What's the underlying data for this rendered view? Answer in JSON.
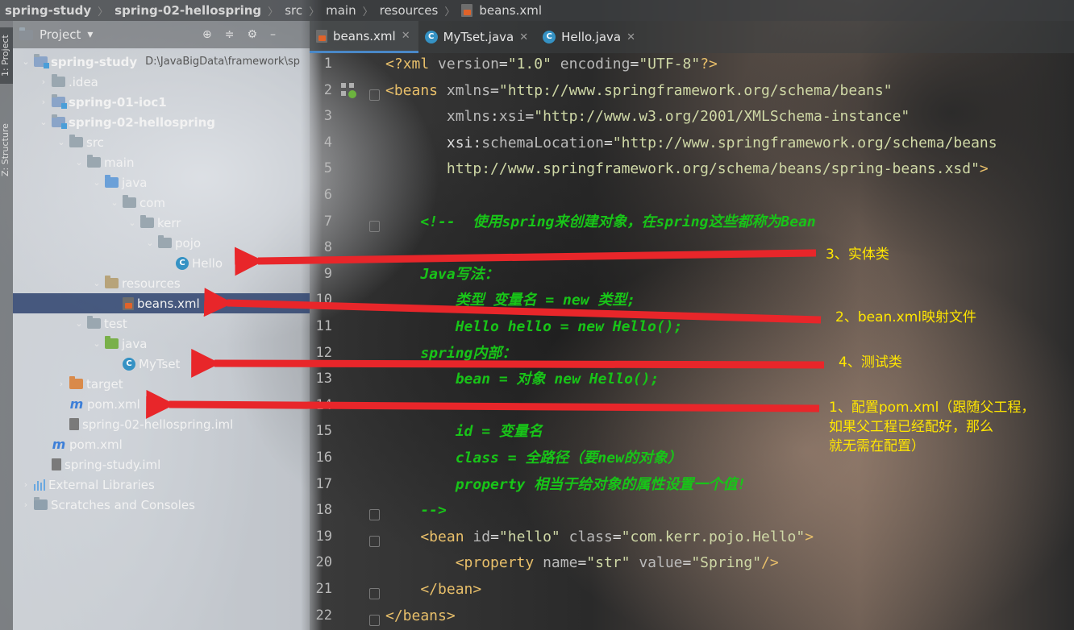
{
  "breadcrumb": {
    "items": [
      "spring-study",
      "spring-02-hellospring",
      "src",
      "main",
      "resources"
    ],
    "file": "beans.xml"
  },
  "left_stripe": {
    "project_label": "1: Project",
    "structure_label": "Z: Structure"
  },
  "project_panel": {
    "title": "Project",
    "root_path": "D:\\JavaBigData\\framework\\sp",
    "tree": [
      {
        "label": "spring-study",
        "icon": "module-folder-icon",
        "depth": 0,
        "expanded": true
      },
      {
        "label": ".idea",
        "icon": "folder-icon",
        "depth": 1,
        "expanded": false
      },
      {
        "label": "spring-01-ioc1",
        "icon": "module-folder-icon",
        "depth": 1,
        "expanded": false
      },
      {
        "label": "spring-02-hellospring",
        "icon": "module-folder-icon",
        "depth": 1,
        "expanded": true
      },
      {
        "label": "src",
        "icon": "folder-icon",
        "depth": 2,
        "expanded": true
      },
      {
        "label": "main",
        "icon": "folder-icon",
        "depth": 3,
        "expanded": true
      },
      {
        "label": "java",
        "icon": "source-folder-icon",
        "depth": 4,
        "expanded": true
      },
      {
        "label": "com",
        "icon": "package-icon",
        "depth": 5,
        "expanded": true
      },
      {
        "label": "kerr",
        "icon": "package-icon",
        "depth": 6,
        "expanded": true
      },
      {
        "label": "pojo",
        "icon": "package-icon",
        "depth": 7,
        "expanded": true
      },
      {
        "label": "Hello",
        "icon": "class-icon",
        "depth": 8
      },
      {
        "label": "resources",
        "icon": "resources-folder-icon",
        "depth": 4,
        "expanded": true
      },
      {
        "label": "beans.xml",
        "icon": "spring-xml-icon",
        "depth": 5,
        "selected": true
      },
      {
        "label": "test",
        "icon": "folder-icon",
        "depth": 3,
        "expanded": true
      },
      {
        "label": "java",
        "icon": "test-folder-icon",
        "depth": 4,
        "expanded": true
      },
      {
        "label": "MyTset",
        "icon": "class-icon",
        "depth": 5
      },
      {
        "label": "target",
        "icon": "target-folder-icon",
        "depth": 2,
        "expanded": false
      },
      {
        "label": "pom.xml",
        "icon": "maven-icon",
        "depth": 2
      },
      {
        "label": "spring-02-hellospring.iml",
        "icon": "iml-file-icon",
        "depth": 2
      },
      {
        "label": "pom.xml",
        "icon": "maven-icon",
        "depth": 1
      },
      {
        "label": "spring-study.iml",
        "icon": "iml-file-icon",
        "depth": 1
      },
      {
        "label": "External Libraries",
        "icon": "library-icon",
        "depth": 0,
        "expanded": false
      },
      {
        "label": "Scratches and Consoles",
        "icon": "scratches-icon",
        "depth": 0,
        "expanded": false
      }
    ]
  },
  "tabs": [
    {
      "label": "beans.xml",
      "icon": "spring-xml-icon",
      "active": true
    },
    {
      "label": "MyTset.java",
      "icon": "class-icon",
      "active": false
    },
    {
      "label": "Hello.java",
      "icon": "class-icon",
      "active": false
    }
  ],
  "code": {
    "line_numbers": [
      "1",
      "2",
      "3",
      "4",
      "5",
      "6",
      "7",
      "8",
      "9",
      "10",
      "11",
      "12",
      "13",
      "14",
      "15",
      "16",
      "17",
      "18",
      "19",
      "20",
      "21",
      "22"
    ],
    "lines": [
      [
        {
          "t": "<?",
          "c": "t-punct"
        },
        {
          "t": "xml ",
          "c": "t-tag"
        },
        {
          "t": "version",
          "c": "t-attr"
        },
        {
          "t": "=",
          "c": "t-plain"
        },
        {
          "t": "\"1.0\"",
          "c": "t-valx"
        },
        {
          "t": " encoding",
          "c": "t-attr"
        },
        {
          "t": "=",
          "c": "t-plain"
        },
        {
          "t": "\"UTF-8\"",
          "c": "t-valx"
        },
        {
          "t": "?>",
          "c": "t-punct"
        }
      ],
      [
        {
          "t": "<beans ",
          "c": "t-tag"
        },
        {
          "t": "xmlns",
          "c": "t-attr"
        },
        {
          "t": "=",
          "c": "t-plain"
        },
        {
          "t": "\"http://www.springframework.org/schema/beans\"",
          "c": "t-valx"
        }
      ],
      [
        {
          "t": "       xmlns",
          "c": "t-attr"
        },
        {
          "t": ":",
          "c": "t-plain"
        },
        {
          "t": "xsi",
          "c": "t-attr"
        },
        {
          "t": "=",
          "c": "t-plain"
        },
        {
          "t": "\"http://www.w3.org/2001/XMLSchema-instance\"",
          "c": "t-valx"
        }
      ],
      [
        {
          "t": "       xsi",
          "c": "t-plain"
        },
        {
          "t": ":",
          "c": "t-plain"
        },
        {
          "t": "schemaLocation",
          "c": "t-attr"
        },
        {
          "t": "=",
          "c": "t-plain"
        },
        {
          "t": "\"http://www.springframework.org/schema/beans",
          "c": "t-valx"
        }
      ],
      [
        {
          "t": "       http://www.springframework.org/schema/beans/spring-beans.xsd\"",
          "c": "t-valx"
        },
        {
          "t": ">",
          "c": "t-tag"
        }
      ],
      [],
      [
        {
          "t": "    <!--  使用spring来创建对象，在spring这些都称为Bean",
          "c": "t-comment"
        }
      ],
      [],
      [
        {
          "t": "    Java写法：",
          "c": "t-comment"
        }
      ],
      [
        {
          "t": "        类型 变量名 = new 类型;",
          "c": "t-comment"
        }
      ],
      [
        {
          "t": "        Hello hello = new Hello();",
          "c": "t-comment"
        }
      ],
      [
        {
          "t": "    spring内部：",
          "c": "t-comment"
        }
      ],
      [
        {
          "t": "        bean = 对象 new Hello();",
          "c": "t-comment"
        }
      ],
      [],
      [
        {
          "t": "        id = 变量名",
          "c": "t-comment"
        }
      ],
      [
        {
          "t": "        class = 全路径（要new的对象）",
          "c": "t-comment"
        }
      ],
      [
        {
          "t": "        property 相当于给对象的属性设置一个值!",
          "c": "t-comment"
        }
      ],
      [
        {
          "t": "    -->",
          "c": "t-comment"
        }
      ],
      [
        {
          "t": "    <bean ",
          "c": "t-tag"
        },
        {
          "t": "id",
          "c": "t-attr"
        },
        {
          "t": "=",
          "c": "t-plain"
        },
        {
          "t": "\"hello\" ",
          "c": "t-valx"
        },
        {
          "t": "class",
          "c": "t-attr"
        },
        {
          "t": "=",
          "c": "t-plain"
        },
        {
          "t": "\"com.kerr.pojo.Hello\"",
          "c": "t-valx"
        },
        {
          "t": ">",
          "c": "t-tag"
        }
      ],
      [
        {
          "t": "        <property ",
          "c": "t-tag"
        },
        {
          "t": "name",
          "c": "t-attr"
        },
        {
          "t": "=",
          "c": "t-plain"
        },
        {
          "t": "\"str\" ",
          "c": "t-valx"
        },
        {
          "t": "value",
          "c": "t-attr"
        },
        {
          "t": "=",
          "c": "t-plain"
        },
        {
          "t": "\"Spring\"",
          "c": "t-valx"
        },
        {
          "t": "/>",
          "c": "t-tag"
        }
      ],
      [
        {
          "t": "    </bean>",
          "c": "t-tag"
        }
      ],
      [
        {
          "t": "</beans>",
          "c": "t-tag"
        }
      ]
    ]
  },
  "annotations": [
    {
      "id": "note-entity",
      "lines": [
        "3、实体类"
      ]
    },
    {
      "id": "note-beans-xml",
      "lines": [
        "2、bean.xml映射文件"
      ]
    },
    {
      "id": "note-test",
      "lines": [
        "4、测试类"
      ]
    },
    {
      "id": "note-pom",
      "lines": [
        "1、配置pom.xml（跟随父工程，",
        "如果父工程已经配好，那么",
        "就无需在配置）"
      ]
    }
  ],
  "colors": {
    "annotation_text": "#ffe600",
    "arrow": "#e8262a",
    "comment": "#18c418",
    "selection": "#2e436e"
  }
}
